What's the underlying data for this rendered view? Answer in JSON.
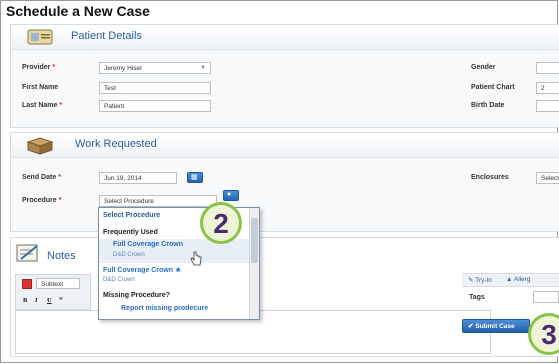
{
  "page": {
    "title": "Schedule a New Case"
  },
  "patient_details": {
    "heading": "Patient Details",
    "provider": {
      "label": "Provider",
      "value": "Jeremy Hiser"
    },
    "first_name": {
      "label": "First Name",
      "value": "Test"
    },
    "last_name": {
      "label": "Last Name",
      "value": "Patient"
    },
    "gender": {
      "label": "Gender"
    },
    "patient_chart": {
      "label": "Patient Chart",
      "value": "2"
    },
    "birth_date": {
      "label": "Birth Date"
    }
  },
  "work_requested": {
    "heading": "Work Requested",
    "send_date": {
      "label": "Send Date",
      "value": "Jun 19, 2014"
    },
    "procedure": {
      "label": "Procedure",
      "value": "Select Procedure"
    },
    "enclosures": {
      "label": "Enclosures",
      "value": "Select"
    }
  },
  "dropdown": {
    "select_label": "Select Procedure",
    "group_frequent": "Frequently Used",
    "item1_name": "Full Coverage Crown",
    "item1_sub": "D&D Crown",
    "item2_name": "Full Coverage Crown ★",
    "item2_sub": "D&D Crown",
    "group_missing": "Missing Procedure?",
    "report_link": "Report missing prodecure"
  },
  "notes": {
    "heading": "Notes",
    "format_select": "Subtext",
    "bold": "B",
    "italic": "I",
    "underline": "U"
  },
  "right_panel": {
    "tryin": "Try-In",
    "allergy": "Allerg",
    "tags_label": "Tags",
    "submit": "✔ Submit Case"
  },
  "badges": {
    "step2": "2",
    "step3": "3"
  },
  "colors": {
    "accent": "#2a5d9b",
    "badge_border": "#8bc24a",
    "badge_text": "#4b2a73",
    "required": "#dd2222"
  }
}
